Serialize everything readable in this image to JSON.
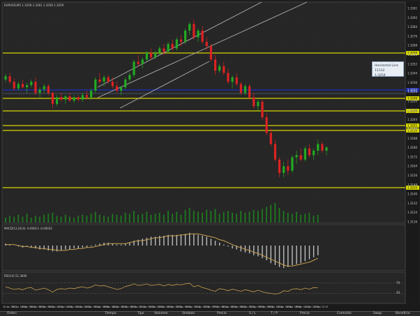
{
  "window": {
    "symbol_header": "EURUSD,M5  1.3258 1.3261 1.3258 1.3259"
  },
  "indicators": {
    "macd_label": "MACD(12,26,9) -0.00013 -0.00032",
    "rsi_label": "RSI(14) 51.3646",
    "rsi_levels": [
      "70",
      "30"
    ]
  },
  "tooltip": {
    "title": "Horizontal Line 11112",
    "value": "1.3254"
  },
  "price_scale": [
    "1.3301",
    "1.3292",
    "1.3284",
    "1.3276",
    "1.3268",
    "1.3260",
    "1.3252",
    "1.3244",
    "1.3236",
    "1.3228",
    "1.3220",
    "1.3212",
    "1.3204",
    "1.3196",
    "1.3188",
    "1.3180",
    "1.3172",
    "1.3164",
    "1.3156",
    "1.3148",
    "1.3140",
    "1.3132",
    "1.3124",
    "1.3116"
  ],
  "hline_labels": [
    "1.3256",
    "1.3237",
    "1.3248",
    "1.3229",
    "1.3221",
    "1.3210",
    "1.3215"
  ],
  "time_scale": [
    "26 Apr 2012",
    "26 Apr 12:00",
    "26 Apr 00:15",
    "26 Apr 00:35",
    "26 Apr 00:55",
    "26 Apr 01:15",
    "26 Apr 01:35",
    "26 Apr 02:15",
    "26 Apr 02:35",
    "26 Apr 03:15",
    "26 Apr 03:55",
    "26 Apr 04:15",
    "26 Apr 04:35",
    "26 Apr 04:55",
    "26 Apr 05:15",
    "26 Apr 05:35",
    "26 Apr 05:55",
    "26 Apr 06:15",
    "26 Apr 06:35",
    "26 Apr 06:55",
    "26 Apr 07:15",
    "26 Apr 07:35",
    "26 Apr 07:55",
    "26 Apr 08:15",
    "26 Apr 08:35",
    "26 Apr 08:55",
    "26 Apr 09:15",
    "26 Apr 09:35",
    "26 Apr 09:55",
    "26 Apr 10:15",
    "26 Apr 10:35",
    "26 Apr 10:55",
    "26 Apr 11:15",
    "26 Apr 11:35",
    "26 Apr 12:15"
  ],
  "bottom_bar": [
    "Orden",
    "Tiempo",
    "Tipo",
    "Volumen",
    "Símbolo",
    "Precio",
    "S / L",
    "T / P",
    "Precio",
    "Comisión",
    "Swap",
    "Beneficio"
  ],
  "colors": {
    "bull": "#22aa22",
    "bear": "#dd2222",
    "hline": "#d6d600",
    "blueline": "#1e2ea8",
    "channel": "#b0b0b0",
    "macd_signal": "#c8a050",
    "rsi": "#c8a050"
  },
  "candles": [
    [
      1.324,
      1.3245,
      1.3238,
      1.3243
    ],
    [
      1.3243,
      1.3246,
      1.3236,
      1.3238
    ],
    [
      1.3238,
      1.3241,
      1.323,
      1.3232
    ],
    [
      1.3232,
      1.3238,
      1.323,
      1.3236
    ],
    [
      1.3236,
      1.324,
      1.3232,
      1.3233
    ],
    [
      1.3233,
      1.3237,
      1.3228,
      1.3235
    ],
    [
      1.3235,
      1.324,
      1.3233,
      1.3238
    ],
    [
      1.3238,
      1.3242,
      1.3226,
      1.3228
    ],
    [
      1.3228,
      1.3233,
      1.3224,
      1.3231
    ],
    [
      1.3231,
      1.3236,
      1.3228,
      1.3234
    ],
    [
      1.3234,
      1.3236,
      1.3226,
      1.3228
    ],
    [
      1.3228,
      1.3229,
      1.3214,
      1.3218
    ],
    [
      1.3218,
      1.3226,
      1.3216,
      1.3224
    ],
    [
      1.3224,
      1.3228,
      1.322,
      1.3222
    ],
    [
      1.3222,
      1.3226,
      1.3218,
      1.3225
    ],
    [
      1.3225,
      1.3228,
      1.322,
      1.3221
    ],
    [
      1.3221,
      1.3226,
      1.3219,
      1.3224
    ],
    [
      1.3224,
      1.3226,
      1.322,
      1.3222
    ],
    [
      1.3222,
      1.3228,
      1.322,
      1.3226
    ],
    [
      1.3226,
      1.323,
      1.3222,
      1.3224
    ],
    [
      1.3224,
      1.3232,
      1.3222,
      1.323
    ],
    [
      1.323,
      1.3242,
      1.3228,
      1.324
    ],
    [
      1.324,
      1.3246,
      1.3236,
      1.3238
    ],
    [
      1.3238,
      1.3244,
      1.3234,
      1.3242
    ],
    [
      1.3242,
      1.3244,
      1.3236,
      1.3238
    ],
    [
      1.3238,
      1.3242,
      1.3232,
      1.3234
    ],
    [
      1.3234,
      1.3238,
      1.3228,
      1.323
    ],
    [
      1.323,
      1.3234,
      1.3226,
      1.3233
    ],
    [
      1.3233,
      1.3242,
      1.3231,
      1.324
    ],
    [
      1.324,
      1.3246,
      1.3238,
      1.3244
    ],
    [
      1.3244,
      1.3258,
      1.3242,
      1.3256
    ],
    [
      1.3256,
      1.3262,
      1.3252,
      1.3254
    ],
    [
      1.3254,
      1.326,
      1.325,
      1.3258
    ],
    [
      1.3258,
      1.3266,
      1.3256,
      1.3264
    ],
    [
      1.3264,
      1.3268,
      1.3258,
      1.326
    ],
    [
      1.326,
      1.3266,
      1.3258,
      1.3264
    ],
    [
      1.3264,
      1.327,
      1.3262,
      1.3268
    ],
    [
      1.3268,
      1.3272,
      1.3262,
      1.3265
    ],
    [
      1.3265,
      1.3274,
      1.3264,
      1.3272
    ],
    [
      1.3272,
      1.3276,
      1.3266,
      1.3268
    ],
    [
      1.3268,
      1.3278,
      1.3266,
      1.3276
    ],
    [
      1.3276,
      1.328,
      1.327,
      1.3274
    ],
    [
      1.3274,
      1.3286,
      1.3272,
      1.3284
    ],
    [
      1.3284,
      1.3292,
      1.328,
      1.329
    ],
    [
      1.329,
      1.3294,
      1.3276,
      1.3278
    ],
    [
      1.3278,
      1.3286,
      1.3274,
      1.3284
    ],
    [
      1.3284,
      1.3288,
      1.3272,
      1.3274
    ],
    [
      1.3274,
      1.3278,
      1.3266,
      1.327
    ],
    [
      1.327,
      1.3272,
      1.3256,
      1.3258
    ],
    [
      1.3258,
      1.3262,
      1.3244,
      1.3248
    ],
    [
      1.3248,
      1.3254,
      1.3246,
      1.3252
    ],
    [
      1.3252,
      1.3256,
      1.3244,
      1.3246
    ],
    [
      1.3246,
      1.325,
      1.3236,
      1.3238
    ],
    [
      1.3238,
      1.3244,
      1.3232,
      1.3242
    ],
    [
      1.3242,
      1.3246,
      1.3234,
      1.3236
    ],
    [
      1.3236,
      1.3238,
      1.3226,
      1.3228
    ],
    [
      1.3228,
      1.3236,
      1.3226,
      1.3234
    ],
    [
      1.3234,
      1.3236,
      1.3222,
      1.3224
    ],
    [
      1.3224,
      1.3228,
      1.3214,
      1.3216
    ],
    [
      1.3216,
      1.3222,
      1.3212,
      1.322
    ],
    [
      1.322,
      1.3222,
      1.3204,
      1.3206
    ],
    [
      1.3206,
      1.321,
      1.319,
      1.3192
    ],
    [
      1.3192,
      1.3196,
      1.318,
      1.3182
    ],
    [
      1.3182,
      1.3186,
      1.3166,
      1.3168
    ],
    [
      1.3168,
      1.317,
      1.3152,
      1.3156
    ],
    [
      1.3156,
      1.3166,
      1.3152,
      1.3162
    ],
    [
      1.3162,
      1.3168,
      1.3154,
      1.3158
    ],
    [
      1.3158,
      1.3172,
      1.3156,
      1.317
    ],
    [
      1.317,
      1.3176,
      1.3164,
      1.3172
    ],
    [
      1.3172,
      1.3178,
      1.3166,
      1.3168
    ],
    [
      1.3168,
      1.318,
      1.3166,
      1.3178
    ],
    [
      1.3178,
      1.3182,
      1.317,
      1.3172
    ],
    [
      1.3172,
      1.3178,
      1.3168,
      1.3176
    ],
    [
      1.3176,
      1.3186,
      1.3172,
      1.3182
    ],
    [
      1.3182,
      1.3184,
      1.3174,
      1.3176
    ],
    [
      1.3176,
      1.318,
      1.3172,
      1.3179
    ]
  ],
  "volume": [
    5,
    7,
    6,
    8,
    6,
    9,
    5,
    7,
    6,
    8,
    9,
    10,
    7,
    6,
    8,
    6,
    5,
    7,
    8,
    7,
    9,
    11,
    8,
    7,
    6,
    9,
    8,
    7,
    10,
    9,
    12,
    8,
    9,
    11,
    8,
    9,
    10,
    8,
    12,
    9,
    11,
    8,
    13,
    15,
    12,
    11,
    10,
    13,
    12,
    14,
    9,
    11,
    12,
    10,
    9,
    12,
    10,
    11,
    13,
    12,
    14,
    16,
    18,
    20,
    15,
    12,
    10,
    9,
    11,
    8,
    9,
    10,
    7,
    8
  ],
  "macd_hist": [
    0.2,
    0.1,
    0.0,
    -0.1,
    -0.2,
    -0.1,
    -0.2,
    -0.3,
    -0.4,
    -0.4,
    -0.5,
    -0.6,
    -0.6,
    -0.5,
    -0.4,
    -0.4,
    -0.3,
    -0.3,
    -0.2,
    -0.2,
    -0.1,
    0.1,
    0.2,
    0.3,
    0.3,
    0.2,
    0.1,
    0.1,
    0.2,
    0.3,
    0.5,
    0.6,
    0.7,
    0.8,
    0.9,
    0.9,
    1.0,
    1.0,
    1.1,
    1.1,
    1.1,
    1.1,
    1.2,
    1.3,
    1.2,
    1.1,
    1.0,
    0.9,
    0.7,
    0.5,
    0.3,
    0.1,
    -0.1,
    -0.3,
    -0.4,
    -0.6,
    -0.7,
    -0.8,
    -1.0,
    -1.1,
    -1.3,
    -1.5,
    -1.8,
    -2.0,
    -2.2,
    -2.3,
    -2.2,
    -2.0,
    -1.9,
    -1.8,
    -1.6,
    -1.4,
    -1.2,
    -1.0
  ],
  "macd_signal": [
    0.1,
    0.1,
    0.1,
    0.0,
    -0.1,
    -0.1,
    -0.2,
    -0.2,
    -0.3,
    -0.3,
    -0.4,
    -0.4,
    -0.5,
    -0.5,
    -0.5,
    -0.4,
    -0.4,
    -0.3,
    -0.3,
    -0.2,
    -0.2,
    -0.1,
    0.0,
    0.1,
    0.2,
    0.2,
    0.2,
    0.2,
    0.2,
    0.3,
    0.4,
    0.5,
    0.5,
    0.6,
    0.7,
    0.8,
    0.8,
    0.9,
    1.0,
    1.0,
    1.0,
    1.1,
    1.1,
    1.2,
    1.2,
    1.2,
    1.1,
    1.0,
    0.9,
    0.8,
    0.6,
    0.5,
    0.3,
    0.1,
    -0.1,
    -0.2,
    -0.4,
    -0.5,
    -0.7,
    -0.8,
    -1.0,
    -1.2,
    -1.4,
    -1.6,
    -1.8,
    -2.0,
    -2.1,
    -2.1,
    -2.0,
    -1.9,
    -1.8,
    -1.7,
    -1.5,
    -1.3
  ],
  "rsi": [
    55,
    50,
    45,
    48,
    44,
    50,
    52,
    42,
    46,
    50,
    44,
    35,
    45,
    48,
    46,
    50,
    48,
    52,
    55,
    50,
    54,
    62,
    58,
    60,
    55,
    50,
    45,
    48,
    56,
    60,
    66,
    60,
    62,
    66,
    60,
    62,
    64,
    58,
    64,
    60,
    64,
    62,
    66,
    68,
    55,
    60,
    52,
    48,
    42,
    38,
    48,
    45,
    40,
    46,
    42,
    38,
    44,
    40,
    36,
    42,
    36,
    32,
    30,
    28,
    30,
    40,
    38,
    46,
    48,
    44,
    50,
    46,
    52,
    51
  ]
}
